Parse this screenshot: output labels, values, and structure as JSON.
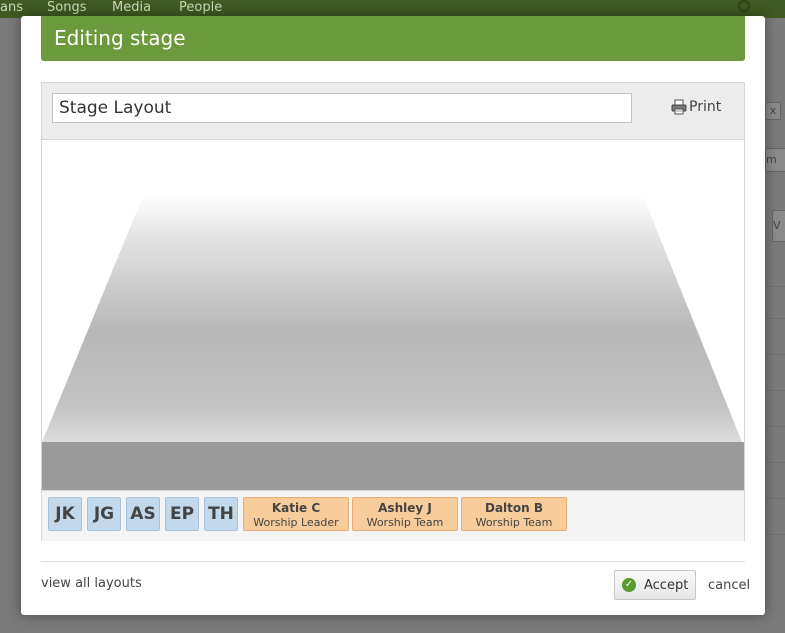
{
  "background": {
    "nav_items": [
      "ans",
      "Songs",
      "Media",
      "People"
    ],
    "side_fragments": [
      "x",
      "m",
      "V"
    ]
  },
  "modal": {
    "title": "Editing stage",
    "layout_name_value": "Stage Layout",
    "print_label": "Print",
    "initials": [
      "JK",
      "JG",
      "AS",
      "EP",
      "TH"
    ],
    "people": [
      {
        "name": "Katie C",
        "role": "Worship Leader"
      },
      {
        "name": "Ashley J",
        "role": "Worship Team"
      },
      {
        "name": "Dalton B",
        "role": "Worship Team"
      }
    ],
    "view_all_label": "view all layouts",
    "accept_label": "Accept",
    "cancel_label": "cancel"
  },
  "colors": {
    "header_green": "#6b9a3c",
    "initial_chip": "#c4d8ec",
    "person_chip": "#f8cc9a"
  }
}
